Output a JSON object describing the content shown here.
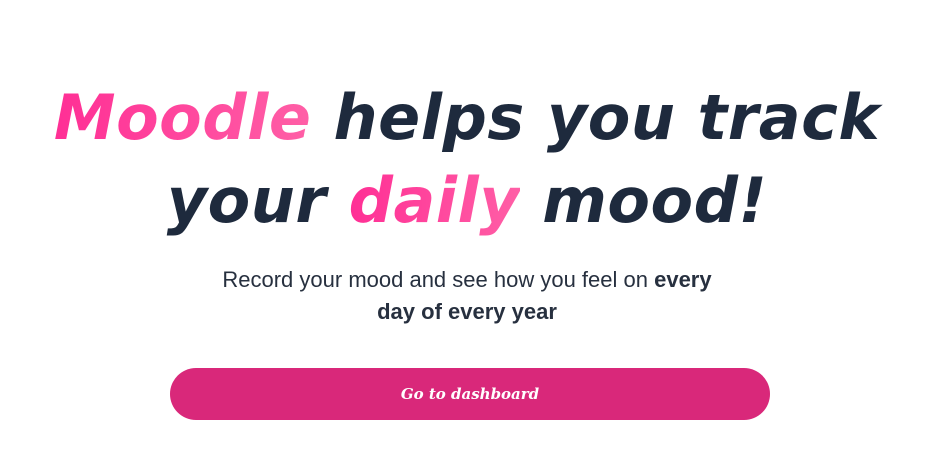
{
  "hero": {
    "title": {
      "line1_accent": "Moodle",
      "line1_rest": " helps you track",
      "line2_prefix": "your ",
      "line2_accent": "daily",
      "line2_suffix": " mood!"
    },
    "subtitle": {
      "line1_text": "Record your mood and see how you feel on ",
      "line1_bold": "every",
      "line2_bold": "day of every year"
    },
    "cta_label": "Go to dashboard"
  },
  "colors": {
    "accent_pink": "#ff3d99",
    "button_pink": "#d9287a",
    "heading_navy": "#1e2a3d",
    "body_text": "#27303f",
    "background": "#ffffff"
  }
}
